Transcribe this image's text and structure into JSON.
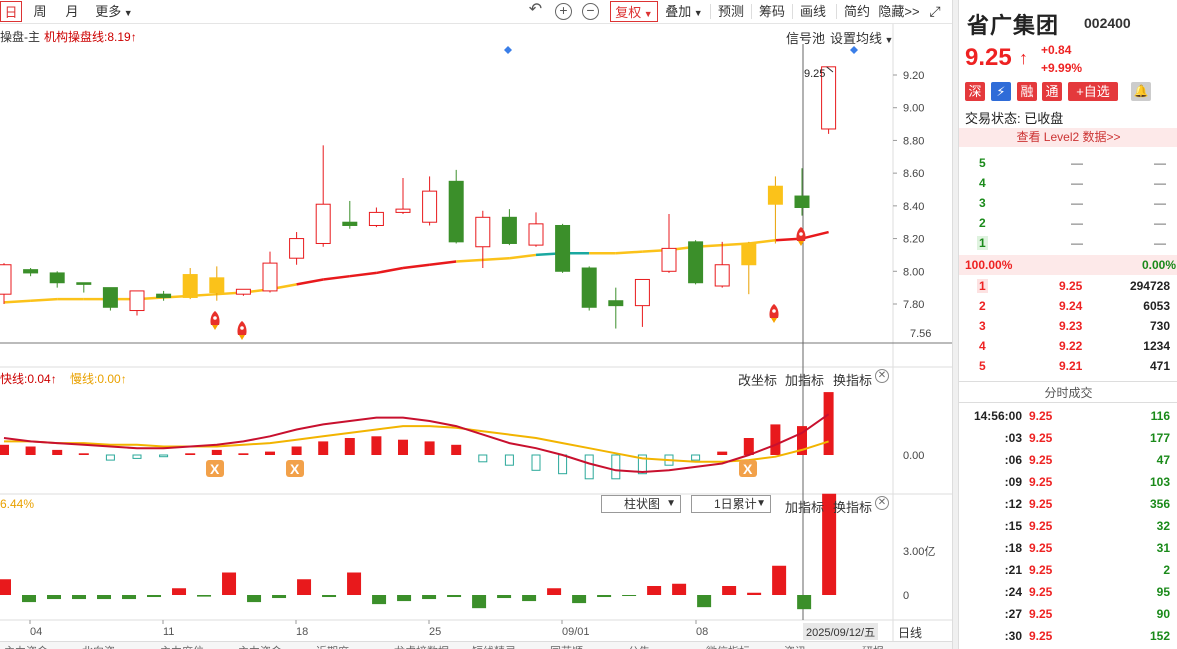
{
  "toolbar": {
    "period_day": "日",
    "period_week": "周",
    "period_month": "月",
    "more": "更多",
    "fuquan": "复权",
    "diejia": "叠加",
    "yuce": "预测",
    "chouma": "筹码",
    "huaxian": "画线",
    "jianyue": "简约",
    "yincang": "隐藏>>"
  },
  "main_panel": {
    "indicator_name": "操盘-主",
    "indicator_line": "机构操盘线:8.19",
    "signal_pool": "信号池",
    "set_ma": "设置均线",
    "price_callout": "9.25"
  },
  "macd_panel": {
    "fast_line": "快线:0.04",
    "slow_line": "慢线:0.00",
    "change_axis": "改坐标",
    "add_indicator": "加指标",
    "switch_indicator": "换指标",
    "zero_label": "0.00"
  },
  "volume_panel": {
    "left_label": "6.44%",
    "chart_type": "柱状图",
    "accum": "1日累计",
    "add_indicator": "加指标",
    "switch_indicator": "换指标",
    "axis_label": "3.00亿",
    "zero_label": "0"
  },
  "date_axis": {
    "labels": [
      "04",
      "11",
      "18",
      "25",
      "09/01",
      "08"
    ],
    "cursor_date": "2025/09/12/五",
    "period": "日线"
  },
  "bottom_tabs": [
    "主力资金",
    "北向资",
    "主力席位",
    "主力资金",
    "近期席",
    "龙虎榜数据",
    "短线精灵",
    "同花顺",
    "公告",
    "微信指标",
    "资讯",
    "研报"
  ],
  "stock": {
    "name": "省广集团",
    "code": "002400",
    "price": "9.25",
    "arrow": "↑",
    "change": "+0.84",
    "change_pct": "+9.99%",
    "tags": [
      "深",
      "⚡",
      "融",
      "通",
      "+自选"
    ],
    "trade_status": "交易状态: 已收盘",
    "level2": "查看 Level2 数据>>"
  },
  "order_book": {
    "sell": [
      {
        "level": "5",
        "price": "—",
        "vol": "—"
      },
      {
        "level": "4",
        "price": "—",
        "vol": "—"
      },
      {
        "level": "3",
        "price": "—",
        "vol": "—"
      },
      {
        "level": "2",
        "price": "—",
        "vol": "—"
      },
      {
        "level": "1",
        "price": "—",
        "vol": "—"
      }
    ],
    "ratio_left": "100.00%",
    "ratio_right": "0.00%",
    "buy": [
      {
        "level": "1",
        "price": "9.25",
        "vol": "294728"
      },
      {
        "level": "2",
        "price": "9.24",
        "vol": "6053"
      },
      {
        "level": "3",
        "price": "9.23",
        "vol": "730"
      },
      {
        "level": "4",
        "price": "9.22",
        "vol": "1234"
      },
      {
        "level": "5",
        "price": "9.21",
        "vol": "471"
      }
    ]
  },
  "ticks": {
    "title": "分时成交",
    "rows": [
      {
        "time": "14:56:00",
        "price": "9.25",
        "vol": "116"
      },
      {
        "time": ":03",
        "price": "9.25",
        "vol": "177"
      },
      {
        "time": ":06",
        "price": "9.25",
        "vol": "47"
      },
      {
        "time": ":09",
        "price": "9.25",
        "vol": "103"
      },
      {
        "time": ":12",
        "price": "9.25",
        "vol": "356"
      },
      {
        "time": ":15",
        "price": "9.25",
        "vol": "32"
      },
      {
        "time": ":18",
        "price": "9.25",
        "vol": "31"
      },
      {
        "time": ":21",
        "price": "9.25",
        "vol": "2"
      },
      {
        "time": ":24",
        "price": "9.25",
        "vol": "95"
      },
      {
        "time": ":27",
        "price": "9.25",
        "vol": "90"
      },
      {
        "time": ":30",
        "price": "9.25",
        "vol": "152"
      }
    ]
  },
  "chart_data": {
    "type": "candlestick",
    "price_axis": [
      "9.20",
      "9.00",
      "8.80",
      "8.60",
      "8.40",
      "8.20",
      "8.00",
      "7.80"
    ],
    "price_low_label": "7.56",
    "ylim": [
      7.56,
      9.32
    ],
    "candles": [
      {
        "o": 7.86,
        "c": 8.04,
        "h": 8.05,
        "l": 7.8,
        "color": "red"
      },
      {
        "o": 8.01,
        "c": 7.99,
        "h": 8.02,
        "l": 7.97,
        "color": "green"
      },
      {
        "o": 7.99,
        "c": 7.93,
        "h": 8.0,
        "l": 7.9,
        "color": "green"
      },
      {
        "o": 7.93,
        "c": 7.92,
        "h": 7.93,
        "l": 7.87,
        "color": "green"
      },
      {
        "o": 7.9,
        "c": 7.78,
        "h": 7.9,
        "l": 7.76,
        "color": "green"
      },
      {
        "o": 7.76,
        "c": 7.88,
        "h": 7.88,
        "l": 7.73,
        "color": "red"
      },
      {
        "o": 7.86,
        "c": 7.84,
        "h": 7.88,
        "l": 7.82,
        "color": "green"
      },
      {
        "o": 7.84,
        "c": 7.98,
        "h": 8.02,
        "l": 7.83,
        "color": "yellow"
      },
      {
        "o": 7.96,
        "c": 7.87,
        "h": 8.03,
        "l": 7.82,
        "color": "yellow"
      },
      {
        "o": 7.86,
        "c": 7.89,
        "h": 7.89,
        "l": 7.85,
        "color": "red"
      },
      {
        "o": 7.88,
        "c": 8.05,
        "h": 8.12,
        "l": 7.87,
        "color": "red"
      },
      {
        "o": 8.08,
        "c": 8.2,
        "h": 8.24,
        "l": 8.04,
        "color": "red"
      },
      {
        "o": 8.17,
        "c": 8.41,
        "h": 8.77,
        "l": 8.15,
        "color": "red"
      },
      {
        "o": 8.3,
        "c": 8.28,
        "h": 8.43,
        "l": 8.26,
        "color": "green"
      },
      {
        "o": 8.28,
        "c": 8.36,
        "h": 8.39,
        "l": 8.27,
        "color": "red"
      },
      {
        "o": 8.36,
        "c": 8.38,
        "h": 8.57,
        "l": 8.35,
        "color": "red"
      },
      {
        "o": 8.3,
        "c": 8.49,
        "h": 8.58,
        "l": 8.28,
        "color": "red"
      },
      {
        "o": 8.55,
        "c": 8.18,
        "h": 8.62,
        "l": 8.17,
        "color": "green"
      },
      {
        "o": 8.15,
        "c": 8.33,
        "h": 8.37,
        "l": 8.02,
        "color": "red"
      },
      {
        "o": 8.33,
        "c": 8.17,
        "h": 8.38,
        "l": 8.16,
        "color": "green"
      },
      {
        "o": 8.16,
        "c": 8.29,
        "h": 8.36,
        "l": 8.15,
        "color": "red"
      },
      {
        "o": 8.28,
        "c": 8.0,
        "h": 8.29,
        "l": 7.99,
        "color": "green"
      },
      {
        "o": 8.02,
        "c": 7.78,
        "h": 8.03,
        "l": 7.76,
        "color": "green"
      },
      {
        "o": 7.82,
        "c": 7.79,
        "h": 7.9,
        "l": 7.65,
        "color": "green"
      },
      {
        "o": 7.79,
        "c": 7.95,
        "h": 7.95,
        "l": 7.66,
        "color": "red"
      },
      {
        "o": 8.0,
        "c": 8.14,
        "h": 8.35,
        "l": 7.99,
        "color": "red"
      },
      {
        "o": 8.18,
        "c": 7.93,
        "h": 8.19,
        "l": 7.92,
        "color": "green"
      },
      {
        "o": 7.91,
        "c": 8.04,
        "h": 8.18,
        "l": 7.9,
        "color": "red"
      },
      {
        "o": 8.17,
        "c": 8.04,
        "h": 8.18,
        "l": 7.86,
        "color": "yellow"
      },
      {
        "o": 8.41,
        "c": 8.52,
        "h": 8.58,
        "l": 8.17,
        "color": "yellow"
      },
      {
        "o": 8.46,
        "c": 8.39,
        "h": 8.63,
        "l": 8.34,
        "color": "green"
      },
      {
        "o": 8.87,
        "c": 9.25,
        "h": 9.25,
        "l": 8.84,
        "color": "red"
      }
    ],
    "ma": [
      7.81,
      7.82,
      7.83,
      7.83,
      7.83,
      7.83,
      7.84,
      7.85,
      7.86,
      7.87,
      7.89,
      7.92,
      7.95,
      7.97,
      7.99,
      8.02,
      8.04,
      8.06,
      8.07,
      8.08,
      8.1,
      8.11,
      8.11,
      8.11,
      8.12,
      8.13,
      8.15,
      8.16,
      8.17,
      8.19,
      8.2,
      8.24
    ],
    "macd_bars": [
      0.06,
      0.05,
      0.03,
      0.01,
      -0.03,
      -0.02,
      -0.01,
      0.01,
      0.03,
      0.01,
      0.02,
      0.05,
      0.08,
      0.1,
      0.11,
      0.09,
      0.08,
      0.06,
      -0.04,
      -0.06,
      -0.09,
      -0.11,
      -0.14,
      -0.14,
      -0.11,
      -0.06,
      -0.03,
      0.02,
      0.1,
      0.18,
      0.17,
      0.37
    ],
    "macd_fast": [
      0.1,
      0.08,
      0.07,
      0.06,
      0.05,
      0.04,
      0.04,
      0.05,
      0.06,
      0.08,
      0.11,
      0.15,
      0.18,
      0.2,
      0.22,
      0.22,
      0.2,
      0.17,
      0.12,
      0.07,
      0.04,
      0.0,
      -0.05,
      -0.09,
      -0.1,
      -0.09,
      -0.07,
      -0.05,
      0.0,
      0.06,
      0.13,
      0.24
    ],
    "macd_slow": [
      0.08,
      0.08,
      0.07,
      0.07,
      0.06,
      0.06,
      0.05,
      0.05,
      0.05,
      0.06,
      0.07,
      0.09,
      0.11,
      0.13,
      0.15,
      0.17,
      0.17,
      0.16,
      0.14,
      0.12,
      0.1,
      0.07,
      0.04,
      0.01,
      -0.02,
      -0.03,
      -0.04,
      -0.04,
      -0.03,
      -0.01,
      0.03,
      0.08
    ],
    "volume": [
      0.35,
      -0.35,
      -0.2,
      -0.2,
      -0.2,
      -0.2,
      -0.1,
      0.15,
      -0.08,
      0.5,
      -0.35,
      -0.15,
      0.35,
      -0.1,
      0.5,
      -0.45,
      -0.3,
      -0.2,
      -0.1,
      -0.65,
      -0.15,
      -0.3,
      0.15,
      -0.4,
      -0.1,
      -0.05,
      0.2,
      0.25,
      -0.6,
      0.2,
      0.05,
      0.65,
      -0.7,
      2.25
    ],
    "volume_max": 3.0
  }
}
